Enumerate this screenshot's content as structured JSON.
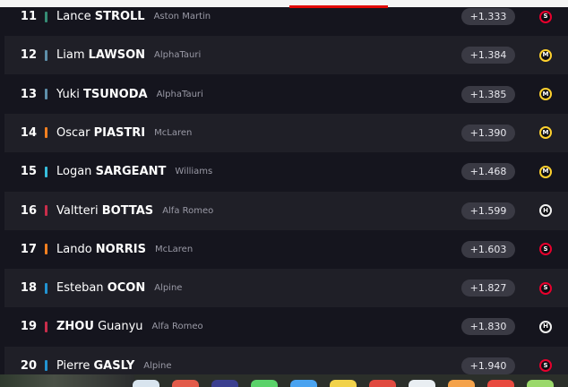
{
  "standings": [
    {
      "pos": "11",
      "first": "Lance",
      "last": "STROLL",
      "team": "Aston Martin",
      "team_color": "#358c75",
      "gap": "+1.333",
      "tyre": "soft",
      "tyre_letter": "S"
    },
    {
      "pos": "12",
      "first": "Liam",
      "last": "LAWSON",
      "team": "AlphaTauri",
      "team_color": "#5e8faa",
      "gap": "+1.384",
      "tyre": "medium",
      "tyre_letter": "M"
    },
    {
      "pos": "13",
      "first": "Yuki",
      "last": "TSUNODA",
      "team": "AlphaTauri",
      "team_color": "#5e8faa",
      "gap": "+1.385",
      "tyre": "medium",
      "tyre_letter": "M"
    },
    {
      "pos": "14",
      "first": "Oscar",
      "last": "PIASTRI",
      "team": "McLaren",
      "team_color": "#f58020",
      "gap": "+1.390",
      "tyre": "medium",
      "tyre_letter": "M"
    },
    {
      "pos": "15",
      "first": "Logan",
      "last": "SARGEANT",
      "team": "Williams",
      "team_color": "#37bedd",
      "gap": "+1.468",
      "tyre": "medium",
      "tyre_letter": "M"
    },
    {
      "pos": "16",
      "first": "Valtteri",
      "last": "BOTTAS",
      "team": "Alfa Romeo",
      "team_color": "#c92d4b",
      "gap": "+1.599",
      "tyre": "hard",
      "tyre_letter": "H"
    },
    {
      "pos": "17",
      "first": "Lando",
      "last": "NORRIS",
      "team": "McLaren",
      "team_color": "#f58020",
      "gap": "+1.603",
      "tyre": "soft",
      "tyre_letter": "S"
    },
    {
      "pos": "18",
      "first": "Esteban",
      "last": "OCON",
      "team": "Alpine",
      "team_color": "#2293d1",
      "gap": "+1.827",
      "tyre": "soft",
      "tyre_letter": "S"
    },
    {
      "pos": "19",
      "first": "Guanyu",
      "last": "ZHOU",
      "last_first": true,
      "team": "Alfa Romeo",
      "team_color": "#c92d4b",
      "gap": "+1.830",
      "tyre": "hard",
      "tyre_letter": "H"
    },
    {
      "pos": "20",
      "first": "Pierre",
      "last": "GASLY",
      "team": "Alpine",
      "team_color": "#2293d1",
      "gap": "+1.940",
      "tyre": "soft",
      "tyre_letter": "S"
    }
  ],
  "colors": {
    "background": "#15151e",
    "row_alt": "#1f1f27",
    "accent": "#e10600"
  },
  "dock": {
    "apps": [
      "app-icon",
      "app-icon",
      "app-icon",
      "app-icon",
      "app-icon",
      "app-icon",
      "app-icon",
      "app-icon",
      "app-icon",
      "app-icon"
    ]
  }
}
